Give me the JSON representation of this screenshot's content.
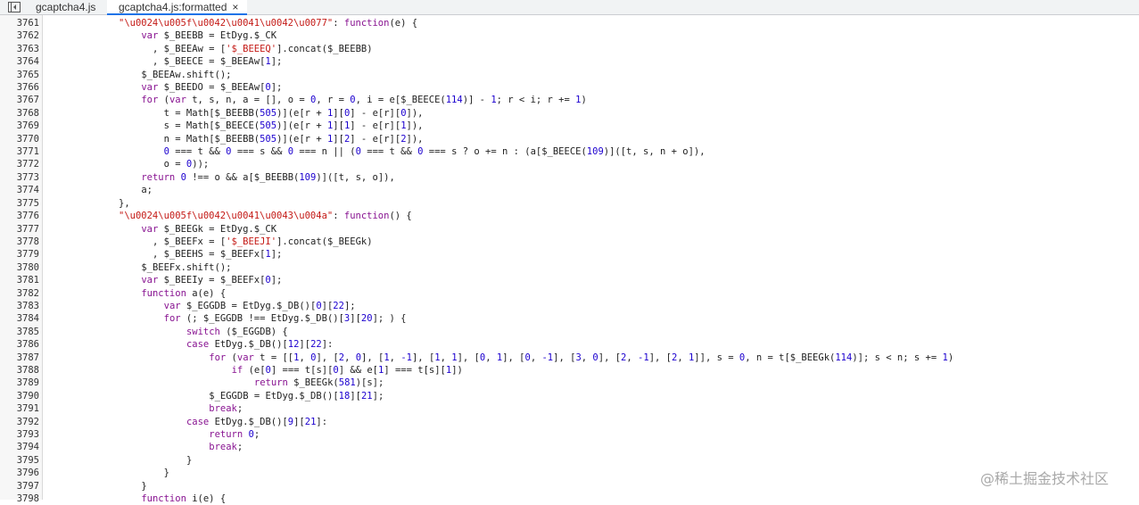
{
  "tabs": [
    {
      "label": "gcaptcha4.js",
      "active": false
    },
    {
      "label": "gcaptcha4.js:formatted",
      "active": true,
      "close_icon": "×"
    }
  ],
  "colors": {
    "keyword": "#881391",
    "string": "#c41a16",
    "number": "#1c00cf",
    "active_tab_underline": "#1a73e8"
  },
  "watermark": "@稀土掘金技术社区",
  "lines": [
    {
      "num": "3761",
      "indent": 4,
      "code": [
        [
          "\"\\u0024\\u005f\\u0042\\u0041\\u0042\\u0077\"",
          "s"
        ],
        [
          ": ",
          ""
        ],
        [
          "function",
          "k"
        ],
        [
          "(e) {",
          ""
        ]
      ]
    },
    {
      "num": "3762",
      "indent": 8,
      "code": [
        [
          "var",
          "k"
        ],
        [
          " $_BEEBB = EtDyg.$_CK",
          ""
        ]
      ]
    },
    {
      "num": "3763",
      "indent": 10,
      "code": [
        [
          ", $_BEEAw = [",
          ""
        ],
        [
          "'$_BEEEQ'",
          "s"
        ],
        [
          "].concat($_BEEBB)",
          ""
        ]
      ]
    },
    {
      "num": "3764",
      "indent": 10,
      "code": [
        [
          ", $_BEECE = $_BEEAw[",
          ""
        ],
        [
          "1",
          "n"
        ],
        [
          "];",
          ""
        ]
      ]
    },
    {
      "num": "3765",
      "indent": 8,
      "code": [
        [
          "$_BEEAw.shift();",
          ""
        ]
      ]
    },
    {
      "num": "3766",
      "indent": 8,
      "code": [
        [
          "var",
          "k"
        ],
        [
          " $_BEEDO = $_BEEAw[",
          ""
        ],
        [
          "0",
          "n"
        ],
        [
          "];",
          ""
        ]
      ]
    },
    {
      "num": "3767",
      "indent": 8,
      "code": [
        [
          "for",
          "k"
        ],
        [
          " (",
          ""
        ],
        [
          "var",
          "k"
        ],
        [
          " t, s, n, a = [], o = ",
          ""
        ],
        [
          "0",
          "n"
        ],
        [
          ", r = ",
          ""
        ],
        [
          "0",
          "n"
        ],
        [
          ", i = e[$_BEECE(",
          ""
        ],
        [
          "114",
          "n"
        ],
        [
          ")] - ",
          ""
        ],
        [
          "1",
          "n"
        ],
        [
          "; r < i; r += ",
          ""
        ],
        [
          "1",
          "n"
        ],
        [
          ")",
          ""
        ]
      ]
    },
    {
      "num": "3768",
      "indent": 12,
      "code": [
        [
          "t = Math[$_BEEBB(",
          ""
        ],
        [
          "505",
          "n"
        ],
        [
          ")](e[r + ",
          ""
        ],
        [
          "1",
          "n"
        ],
        [
          "][",
          ""
        ],
        [
          "0",
          "n"
        ],
        [
          "] - e[r][",
          ""
        ],
        [
          "0",
          "n"
        ],
        [
          "]),",
          ""
        ]
      ]
    },
    {
      "num": "3769",
      "indent": 12,
      "code": [
        [
          "s = Math[$_BEECE(",
          ""
        ],
        [
          "505",
          "n"
        ],
        [
          ")](e[r + ",
          ""
        ],
        [
          "1",
          "n"
        ],
        [
          "][",
          ""
        ],
        [
          "1",
          "n"
        ],
        [
          "] - e[r][",
          ""
        ],
        [
          "1",
          "n"
        ],
        [
          "]),",
          ""
        ]
      ]
    },
    {
      "num": "3770",
      "indent": 12,
      "code": [
        [
          "n = Math[$_BEEBB(",
          ""
        ],
        [
          "505",
          "n"
        ],
        [
          ")](e[r + ",
          ""
        ],
        [
          "1",
          "n"
        ],
        [
          "][",
          ""
        ],
        [
          "2",
          "n"
        ],
        [
          "] - e[r][",
          ""
        ],
        [
          "2",
          "n"
        ],
        [
          "]),",
          ""
        ]
      ]
    },
    {
      "num": "3771",
      "indent": 12,
      "code": [
        [
          "0",
          "n"
        ],
        [
          " === t && ",
          ""
        ],
        [
          "0",
          "n"
        ],
        [
          " === s && ",
          ""
        ],
        [
          "0",
          "n"
        ],
        [
          " === n || (",
          ""
        ],
        [
          "0",
          "n"
        ],
        [
          " === t && ",
          ""
        ],
        [
          "0",
          "n"
        ],
        [
          " === s ? o += n : (a[$_BEECE(",
          ""
        ],
        [
          "109",
          "n"
        ],
        [
          ")]([t, s, n + o]),",
          ""
        ]
      ]
    },
    {
      "num": "3772",
      "indent": 12,
      "code": [
        [
          "o = ",
          ""
        ],
        [
          "0",
          "n"
        ],
        [
          "));",
          ""
        ]
      ]
    },
    {
      "num": "3773",
      "indent": 8,
      "code": [
        [
          "return",
          "k"
        ],
        [
          " ",
          ""
        ],
        [
          "0",
          "n"
        ],
        [
          " !== o && a[$_BEEBB(",
          ""
        ],
        [
          "109",
          "n"
        ],
        [
          ")]([t, s, o]),",
          ""
        ]
      ]
    },
    {
      "num": "3774",
      "indent": 8,
      "code": [
        [
          "a;",
          ""
        ]
      ]
    },
    {
      "num": "3775",
      "indent": 4,
      "code": [
        [
          "},",
          ""
        ]
      ]
    },
    {
      "num": "3776",
      "indent": 4,
      "code": [
        [
          "\"\\u0024\\u005f\\u0042\\u0041\\u0043\\u004a\"",
          "s"
        ],
        [
          ": ",
          ""
        ],
        [
          "function",
          "k"
        ],
        [
          "() {",
          ""
        ]
      ]
    },
    {
      "num": "3777",
      "indent": 8,
      "code": [
        [
          "var",
          "k"
        ],
        [
          " $_BEEGk = EtDyg.$_CK",
          ""
        ]
      ]
    },
    {
      "num": "3778",
      "indent": 10,
      "code": [
        [
          ", $_BEEFx = [",
          ""
        ],
        [
          "'$_BEEJI'",
          "s"
        ],
        [
          "].concat($_BEEGk)",
          ""
        ]
      ]
    },
    {
      "num": "3779",
      "indent": 10,
      "code": [
        [
          ", $_BEEHS = $_BEEFx[",
          ""
        ],
        [
          "1",
          "n"
        ],
        [
          "];",
          ""
        ]
      ]
    },
    {
      "num": "3780",
      "indent": 8,
      "code": [
        [
          "$_BEEFx.shift();",
          ""
        ]
      ]
    },
    {
      "num": "3781",
      "indent": 8,
      "code": [
        [
          "var",
          "k"
        ],
        [
          " $_BEEIy = $_BEEFx[",
          ""
        ],
        [
          "0",
          "n"
        ],
        [
          "];",
          ""
        ]
      ]
    },
    {
      "num": "3782",
      "indent": 8,
      "code": [
        [
          "function",
          "k"
        ],
        [
          " a(e) {",
          ""
        ]
      ]
    },
    {
      "num": "3783",
      "indent": 12,
      "code": [
        [
          "var",
          "k"
        ],
        [
          " $_EGGDB = EtDyg.$_DB()[",
          ""
        ],
        [
          "0",
          "n"
        ],
        [
          "][",
          ""
        ],
        [
          "22",
          "n"
        ],
        [
          "];",
          ""
        ]
      ]
    },
    {
      "num": "3784",
      "indent": 12,
      "code": [
        [
          "for",
          "k"
        ],
        [
          " (; $_EGGDB !== EtDyg.$_DB()[",
          ""
        ],
        [
          "3",
          "n"
        ],
        [
          "][",
          ""
        ],
        [
          "20",
          "n"
        ],
        [
          "]; ) {",
          ""
        ]
      ]
    },
    {
      "num": "3785",
      "indent": 16,
      "code": [
        [
          "switch",
          "k"
        ],
        [
          " ($_EGGDB) {",
          ""
        ]
      ]
    },
    {
      "num": "3786",
      "indent": 16,
      "code": [
        [
          "case",
          "k"
        ],
        [
          " EtDyg.$_DB()[",
          ""
        ],
        [
          "12",
          "n"
        ],
        [
          "][",
          ""
        ],
        [
          "22",
          "n"
        ],
        [
          "]:",
          ""
        ]
      ]
    },
    {
      "num": "3787",
      "indent": 20,
      "code": [
        [
          "for",
          "k"
        ],
        [
          " (",
          ""
        ],
        [
          "var",
          "k"
        ],
        [
          " t = [[",
          ""
        ],
        [
          "1",
          "n"
        ],
        [
          ", ",
          ""
        ],
        [
          "0",
          "n"
        ],
        [
          "], [",
          ""
        ],
        [
          "2",
          "n"
        ],
        [
          ", ",
          ""
        ],
        [
          "0",
          "n"
        ],
        [
          "], [",
          ""
        ],
        [
          "1",
          "n"
        ],
        [
          ", ",
          ""
        ],
        [
          "-1",
          "n"
        ],
        [
          "], [",
          ""
        ],
        [
          "1",
          "n"
        ],
        [
          ", ",
          ""
        ],
        [
          "1",
          "n"
        ],
        [
          "], [",
          ""
        ],
        [
          "0",
          "n"
        ],
        [
          ", ",
          ""
        ],
        [
          "1",
          "n"
        ],
        [
          "], [",
          ""
        ],
        [
          "0",
          "n"
        ],
        [
          ", ",
          ""
        ],
        [
          "-1",
          "n"
        ],
        [
          "], [",
          ""
        ],
        [
          "3",
          "n"
        ],
        [
          ", ",
          ""
        ],
        [
          "0",
          "n"
        ],
        [
          "], [",
          ""
        ],
        [
          "2",
          "n"
        ],
        [
          ", ",
          ""
        ],
        [
          "-1",
          "n"
        ],
        [
          "], [",
          ""
        ],
        [
          "2",
          "n"
        ],
        [
          ", ",
          ""
        ],
        [
          "1",
          "n"
        ],
        [
          "]], s = ",
          ""
        ],
        [
          "0",
          "n"
        ],
        [
          ", n = t[$_BEEGk(",
          ""
        ],
        [
          "114",
          "n"
        ],
        [
          ")]; s < n; s += ",
          ""
        ],
        [
          "1",
          "n"
        ],
        [
          ")",
          ""
        ]
      ]
    },
    {
      "num": "3788",
      "indent": 24,
      "code": [
        [
          "if",
          "k"
        ],
        [
          " (e[",
          ""
        ],
        [
          "0",
          "n"
        ],
        [
          "] === t[s][",
          ""
        ],
        [
          "0",
          "n"
        ],
        [
          "] && e[",
          ""
        ],
        [
          "1",
          "n"
        ],
        [
          "] === t[s][",
          ""
        ],
        [
          "1",
          "n"
        ],
        [
          "])",
          ""
        ]
      ]
    },
    {
      "num": "3789",
      "indent": 28,
      "code": [
        [
          "return",
          "k"
        ],
        [
          " $_BEEGk(",
          ""
        ],
        [
          "581",
          "n"
        ],
        [
          ")[s];",
          ""
        ]
      ]
    },
    {
      "num": "3790",
      "indent": 20,
      "code": [
        [
          "$_EGGDB = EtDyg.$_DB()[",
          ""
        ],
        [
          "18",
          "n"
        ],
        [
          "][",
          ""
        ],
        [
          "21",
          "n"
        ],
        [
          "];",
          ""
        ]
      ]
    },
    {
      "num": "3791",
      "indent": 20,
      "code": [
        [
          "break",
          "k"
        ],
        [
          ";",
          ""
        ]
      ]
    },
    {
      "num": "3792",
      "indent": 16,
      "code": [
        [
          "case",
          "k"
        ],
        [
          " EtDyg.$_DB()[",
          ""
        ],
        [
          "9",
          "n"
        ],
        [
          "][",
          ""
        ],
        [
          "21",
          "n"
        ],
        [
          "]:",
          ""
        ]
      ]
    },
    {
      "num": "3793",
      "indent": 20,
      "code": [
        [
          "return",
          "k"
        ],
        [
          " ",
          ""
        ],
        [
          "0",
          "n"
        ],
        [
          ";",
          ""
        ]
      ]
    },
    {
      "num": "3794",
      "indent": 20,
      "code": [
        [
          "break",
          "k"
        ],
        [
          ";",
          ""
        ]
      ]
    },
    {
      "num": "3795",
      "indent": 16,
      "code": [
        [
          "}",
          ""
        ]
      ]
    },
    {
      "num": "3796",
      "indent": 12,
      "code": [
        [
          "}",
          ""
        ]
      ]
    },
    {
      "num": "3797",
      "indent": 8,
      "code": [
        [
          "}",
          ""
        ]
      ]
    },
    {
      "num": "3798",
      "indent": 8,
      "code": [
        [
          "function",
          "k"
        ],
        [
          " i(e) {",
          ""
        ]
      ]
    }
  ]
}
